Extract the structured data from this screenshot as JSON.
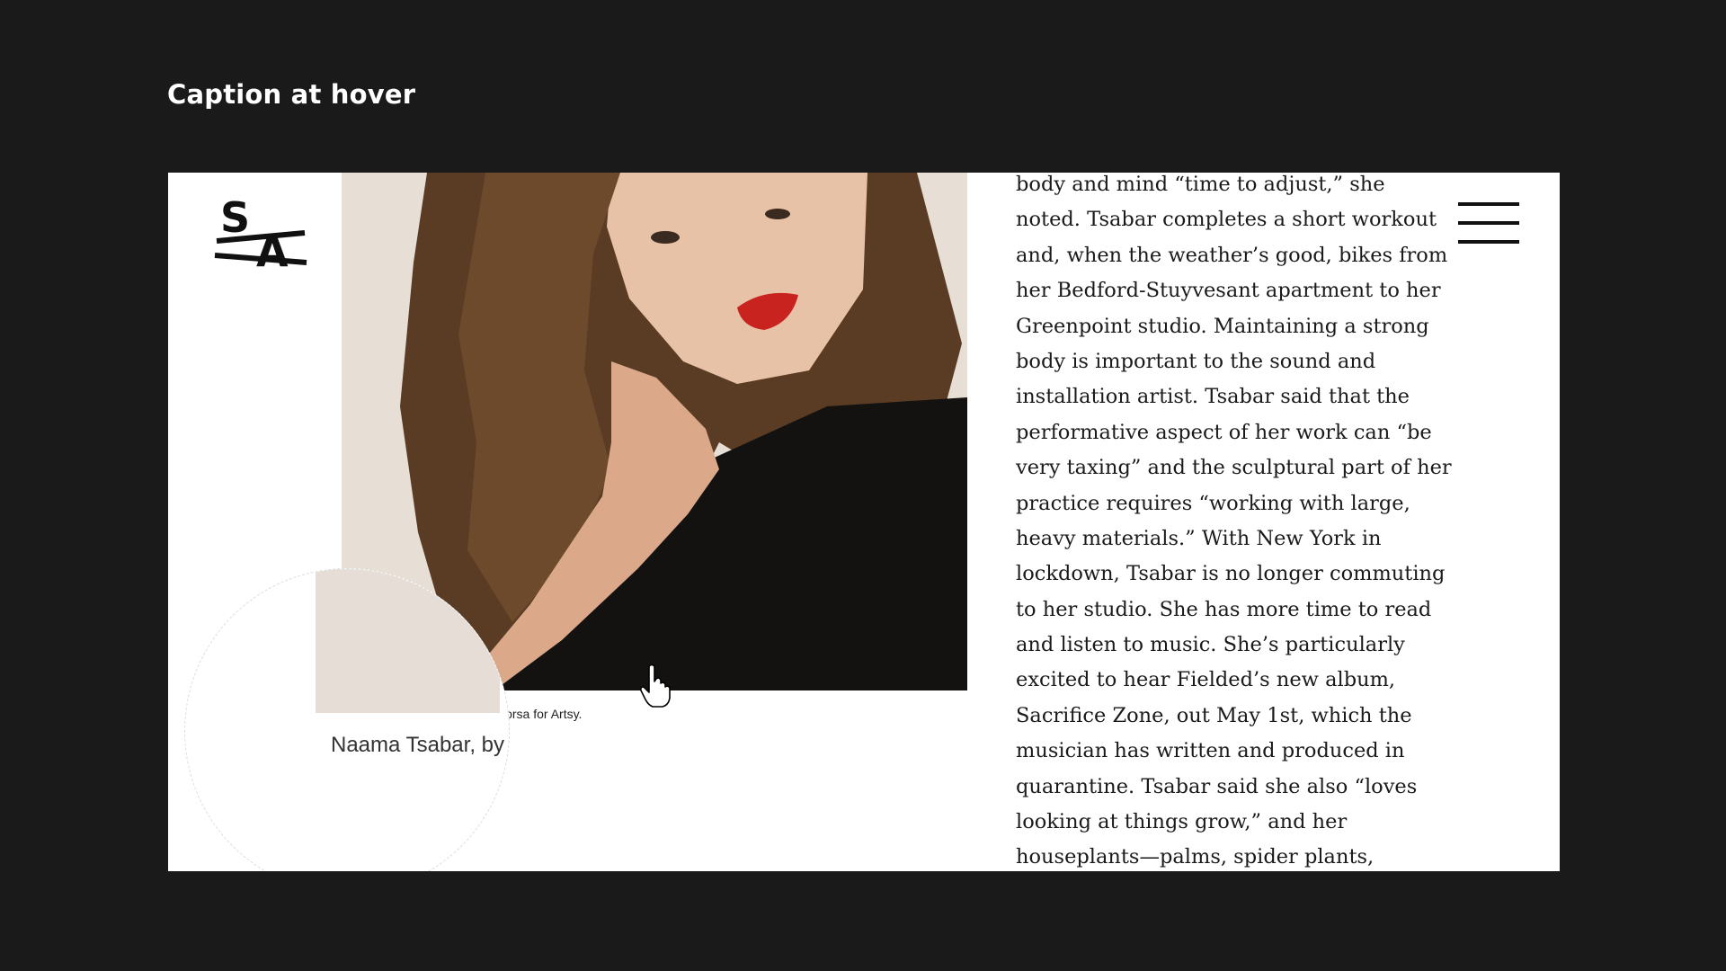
{
  "slide": {
    "title": "Caption at hover"
  },
  "site": {
    "logo": {
      "top_letter": "S",
      "bottom_letter": "A"
    },
    "menu": {
      "icon": "hamburger-menu-icon"
    }
  },
  "photo": {
    "caption_partial": "Dorsa for Artsy.",
    "magnified_caption": "Naama Tsabar, by"
  },
  "article": {
    "lines": [
      "body and mind “time to adjust,” she",
      "noted. Tsabar completes a short workout",
      "and, when the weather’s good, bikes from",
      "her Bedford-Stuyvesant apartment to her",
      "Greenpoint studio. Maintaining a strong",
      "body is important to the sound and",
      "installation artist. Tsabar said that the",
      "performative aspect of her work can “be",
      "very taxing” and the sculptural part of her",
      "practice requires “working with large,",
      "heavy materials.” With New York in",
      "lockdown, Tsabar is no longer commuting",
      "to her studio. She has more time to read",
      "and listen to music. She’s particularly",
      "excited to hear Fielded’s new album,",
      "Sacrifice Zone, out May 1st, which the",
      "musician has written and produced in",
      "quarantine. Tsabar said she also “loves",
      "looking at things grow,” and her",
      "houseplants—palms, spider plants,"
    ]
  },
  "colors": {
    "background": "#1a1a1a",
    "page": "#ffffff",
    "lipstick": "#c8231e"
  }
}
